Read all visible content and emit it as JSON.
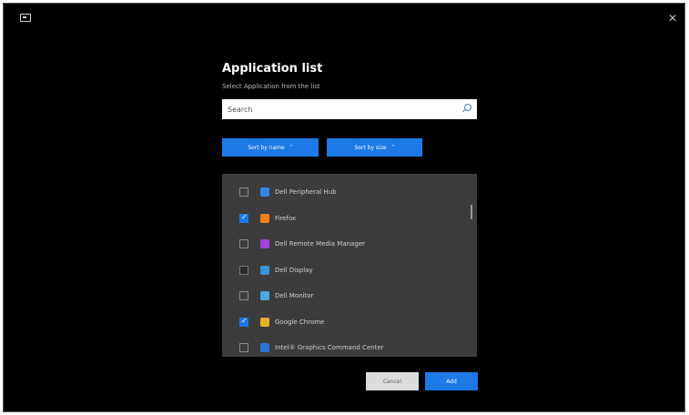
{
  "window": {
    "close_glyph": "✕"
  },
  "dialog": {
    "title": "Application list",
    "subtitle": "Select Application from the list",
    "search": {
      "value": "",
      "placeholder": "Search"
    },
    "filter_button_1": {
      "label": "Sort by name",
      "chevron": "˅"
    },
    "filter_button_2": {
      "label": "Sort by size",
      "chevron": "˅"
    },
    "items": [
      {
        "label": "Dell Peripheral Hub",
        "checked": false,
        "icon": "app-blue-icon",
        "color": "#2f8ae8"
      },
      {
        "label": "Firefox",
        "checked": true,
        "icon": "firefox-icon",
        "color": "#ef7d1d"
      },
      {
        "label": "Dell Remote Media Manager",
        "checked": false,
        "icon": "app-purple-icon",
        "color": "#a043d8"
      },
      {
        "label": "Dell Display",
        "checked": false,
        "icon": "app-lightblue-icon",
        "color": "#3b92d6"
      },
      {
        "label": "Dell Monitor",
        "checked": false,
        "icon": "app-cyan-icon",
        "color": "#49a7e3"
      },
      {
        "label": "Google Chrome",
        "checked": true,
        "icon": "chrome-icon",
        "color": "#e8b12a"
      },
      {
        "label": "Intel® Graphics Command Center",
        "checked": false,
        "icon": "app-intel-icon",
        "color": "#2b73d4"
      }
    ],
    "cancel_label": "Cancel",
    "add_label": "Add"
  },
  "colors": {
    "accent": "#1d79e6",
    "list_bg": "#3c3c3c",
    "window_bg": "#000000"
  }
}
